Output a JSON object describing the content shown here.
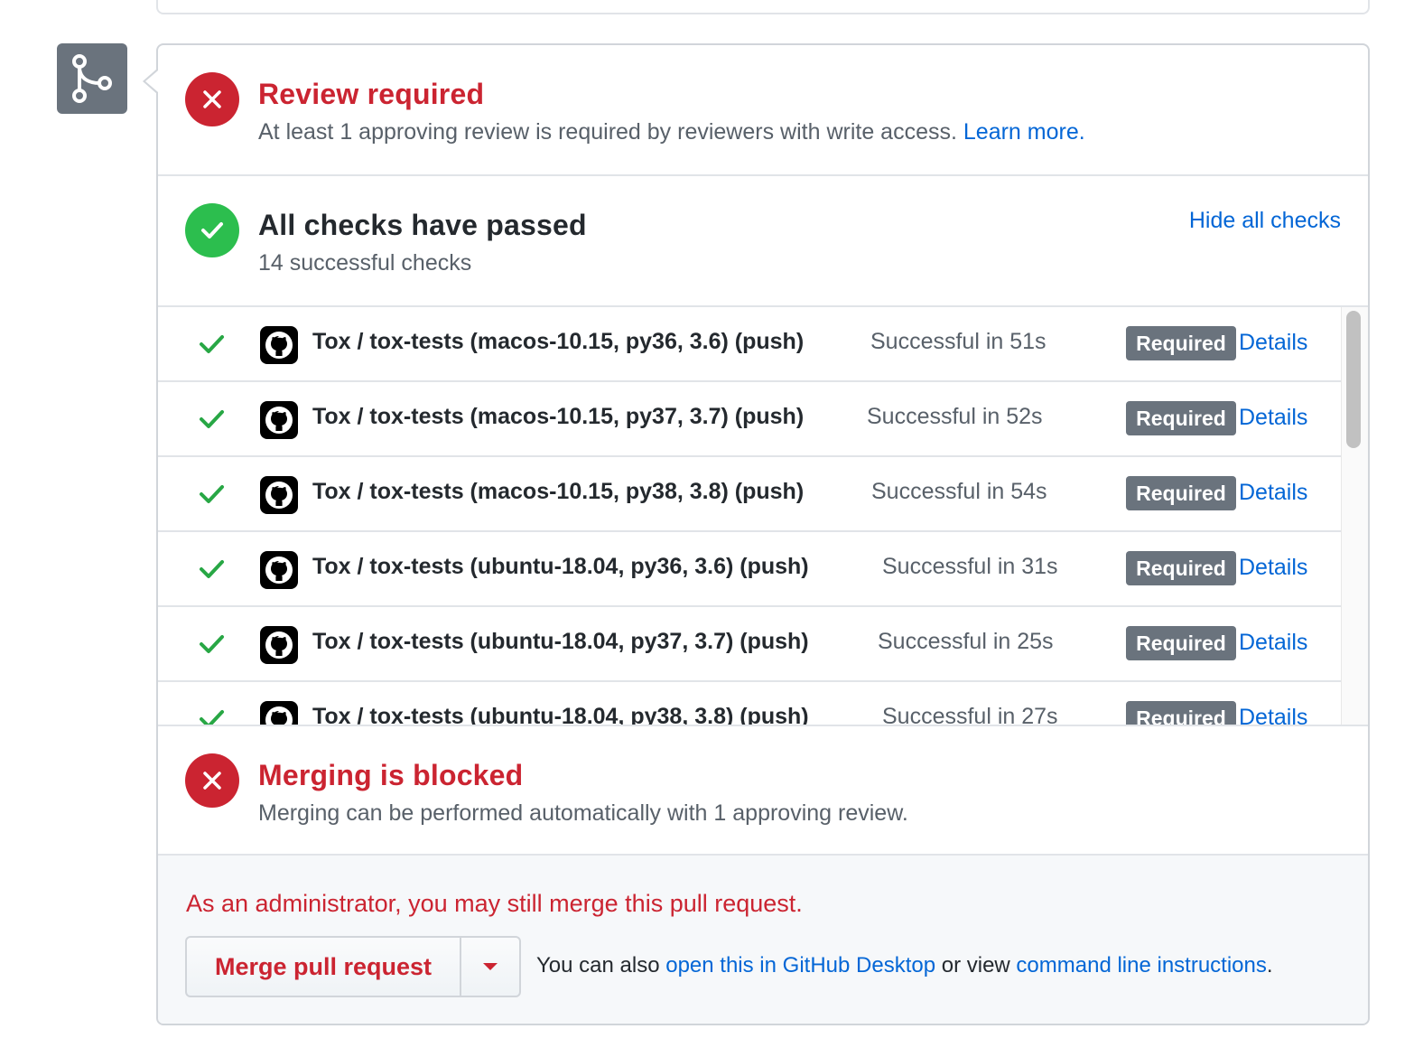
{
  "review": {
    "title": "Review required",
    "description": "At least 1 approving review is required by reviewers with write access.",
    "learn_more": "Learn more."
  },
  "checks": {
    "title": "All checks have passed",
    "subtitle": "14 successful checks",
    "toggle_label": "Hide all checks",
    "items": [
      {
        "name": "Tox / tox-tests (macos-10.15, py36, 3.6) (push)",
        "status": "Successful in 51s",
        "badge": "Required",
        "link": "Details"
      },
      {
        "name": "Tox / tox-tests (macos-10.15, py37, 3.7) (push)",
        "status": "Successful in 52s",
        "badge": "Required",
        "link": "Details"
      },
      {
        "name": "Tox / tox-tests (macos-10.15, py38, 3.8) (push)",
        "status": "Successful in 54s",
        "badge": "Required",
        "link": "Details"
      },
      {
        "name": "Tox / tox-tests (ubuntu-18.04, py36, 3.6) (push)",
        "status": "Successful in 31s",
        "badge": "Required",
        "link": "Details"
      },
      {
        "name": "Tox / tox-tests (ubuntu-18.04, py37, 3.7) (push)",
        "status": "Successful in 25s",
        "badge": "Required",
        "link": "Details"
      },
      {
        "name": "Tox / tox-tests (ubuntu-18.04, py38, 3.8) (push)",
        "status": "Successful in 27s",
        "badge": "Required",
        "link": "Details"
      }
    ]
  },
  "blocked": {
    "title": "Merging is blocked",
    "description": "Merging can be performed automatically with 1 approving review."
  },
  "admin": {
    "notice": "As an administrator, you may still merge this pull request.",
    "merge_button": "Merge pull request",
    "also_prefix": "You can also ",
    "desktop_link": "open this in GitHub Desktop",
    "middle_text": " or view ",
    "cli_link": "command line instructions",
    "suffix": "."
  },
  "colors": {
    "danger": "#cb2431",
    "success": "#2cbe4e",
    "link": "#0366d6",
    "badge": "#6a737d"
  }
}
